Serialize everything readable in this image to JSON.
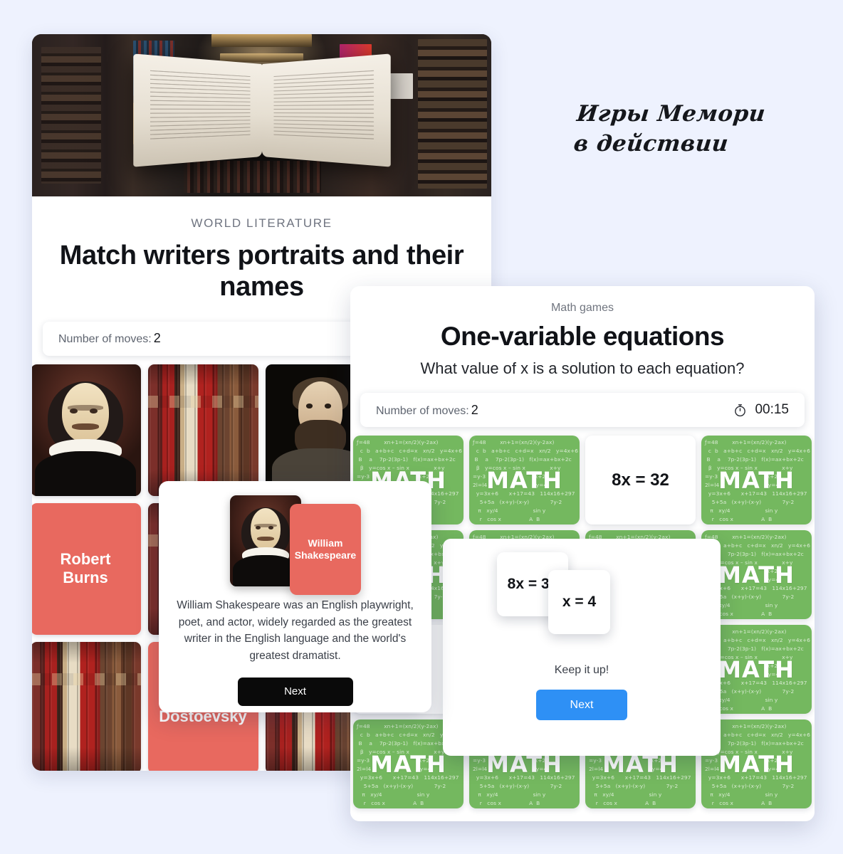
{
  "caption": "Игры Мемори\nв действии",
  "background_color": "#eef2fe",
  "literature_game": {
    "eyebrow": "WORLD LITERATURE",
    "title": "Match writers portraits and their names",
    "moves_label": "Number of moves:",
    "moves_value": "2",
    "hero_image_alt": "open-book-in-bookstore",
    "cards": [
      {
        "type": "portrait",
        "person": "William Shakespeare"
      },
      {
        "type": "back",
        "person": ""
      },
      {
        "type": "portrait",
        "person": "Fyodor Dostoevsky"
      },
      {
        "type": "back",
        "person": ""
      },
      {
        "type": "name",
        "person": "Robert Burns"
      },
      {
        "type": "back",
        "person": ""
      },
      {
        "type": "name",
        "person": ""
      },
      {
        "type": "back",
        "person": ""
      },
      {
        "type": "back",
        "person": ""
      },
      {
        "type": "name",
        "person": "Fyodor Dostoevsky"
      },
      {
        "type": "back",
        "person": ""
      },
      {
        "type": "back",
        "person": ""
      }
    ],
    "popup": {
      "match_name": "William Shakespeare",
      "description": "William Shakespeare was an English playwright, poet, and actor, widely regarded as the greatest writer in the English language and the world's greatest dramatist.",
      "next_label": "Next"
    },
    "accent_color": "#e8695f",
    "next_button_color": "#0a0a0a"
  },
  "math_game": {
    "eyebrow": "Math games",
    "title": "One-variable equations",
    "subtitle": "What value of x is a solution to each equation?",
    "moves_label": "Number of moves:",
    "moves_value": "2",
    "timer_icon": "stopwatch-icon",
    "timer_value": "00:15",
    "card_back_label": "MATH",
    "card_back_color": "#74b85f",
    "pattern_text": "ƒ=48        xn+1=(xn/2)(y-2ax)\n  c  b   a+b+c   c+d=x   xn/2   y=4x+6\n B    a    7p-2(3p-1)   f(x)=ax+bx+2c\n  β   y=cos x – sin x              x+y\n=y-3                            x+2y\n2l=l4                            y=4\n  y=3x+6      x+17=43   114x16+297\n    5+5a   (x+y)-(x-y)            7y-2\n   π   xy/4                    sin y\n    r   cos x                A  B",
    "cards": [
      {
        "face": "back"
      },
      {
        "face": "back"
      },
      {
        "face": "8x = 32"
      },
      {
        "face": "back"
      },
      {
        "face": "back"
      },
      {
        "face": "back"
      },
      {
        "face": "back"
      },
      {
        "face": "back"
      },
      {
        "face": "x = 4"
      },
      {
        "face": "back"
      },
      {
        "face": "back"
      },
      {
        "face": "back"
      },
      {
        "face": "back"
      },
      {
        "face": "back"
      },
      {
        "face": "back"
      },
      {
        "face": "back"
      }
    ],
    "popup": {
      "card_a": "8x = 32",
      "card_b": "x = 4",
      "message": "Keep it up!",
      "next_label": "Next",
      "next_color": "#2e90f5"
    }
  }
}
